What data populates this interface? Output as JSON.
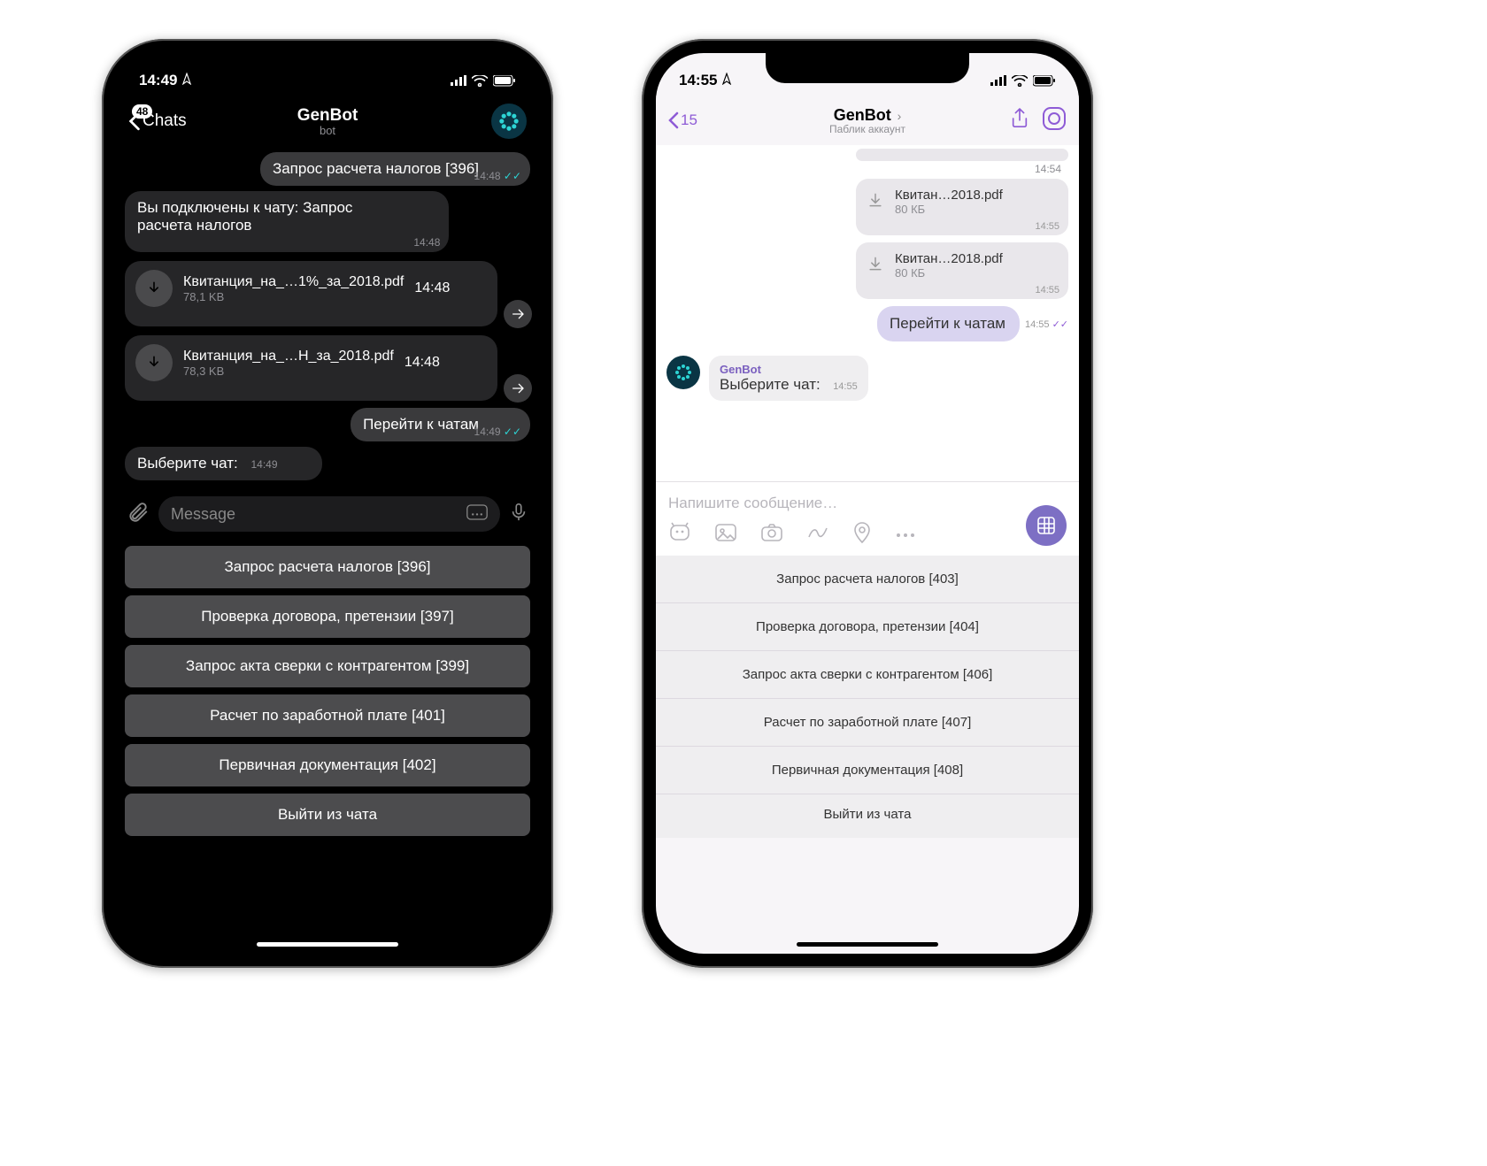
{
  "telegram": {
    "status": {
      "time": "14:49"
    },
    "header": {
      "back_label": "Chats",
      "back_badge": "48",
      "title": "GenBot",
      "subtitle": "bot"
    },
    "messages": {
      "m1": {
        "text": "Запрос расчета налогов [396]",
        "time": "14:48"
      },
      "m2": {
        "text": "Вы подключены к чату: Запрос расчета налогов",
        "time": "14:48"
      },
      "f1": {
        "name": "Квитанция_на_…1%_за_2018.pdf",
        "size": "78,1 KB",
        "time": "14:48"
      },
      "f2": {
        "name": "Квитанция_на_…Н_за_2018.pdf",
        "size": "78,3 KB",
        "time": "14:48"
      },
      "m3": {
        "text": "Перейти к чатам",
        "time": "14:49"
      },
      "m4": {
        "text": "Выберите чат:",
        "time": "14:49"
      }
    },
    "input": {
      "placeholder": "Message"
    },
    "keyboard": [
      "Запрос расчета налогов [396]",
      "Проверка договора, претензии [397]",
      "Запрос акта сверки с контрагентом [399]",
      "Расчет по заработной плате [401]",
      "Первичная документация [402]",
      "Выйти из чата"
    ]
  },
  "viber": {
    "status": {
      "time": "14:55"
    },
    "header": {
      "back_count": "15",
      "title": "GenBot",
      "subtitle": "Паблик аккаунт"
    },
    "messages": {
      "t0": "14:54",
      "f1": {
        "name": "Квитан…2018.pdf",
        "size": "80 КБ",
        "time": "14:55"
      },
      "f2": {
        "name": "Квитан…2018.pdf",
        "size": "80 КБ",
        "time": "14:55"
      },
      "out": {
        "text": "Перейти к чатам",
        "time": "14:55"
      },
      "bot": {
        "name": "GenBot",
        "text": "Выберите чат:",
        "time": "14:55"
      }
    },
    "compose": {
      "placeholder": "Напишите сообщение…"
    },
    "keyboard": [
      "Запрос расчета налогов [403]",
      "Проверка договора, претензии [404]",
      "Запрос акта сверки с контрагентом [406]",
      "Расчет по заработной плате [407]",
      "Первичная документация [408]",
      "Выйти из чата"
    ]
  }
}
